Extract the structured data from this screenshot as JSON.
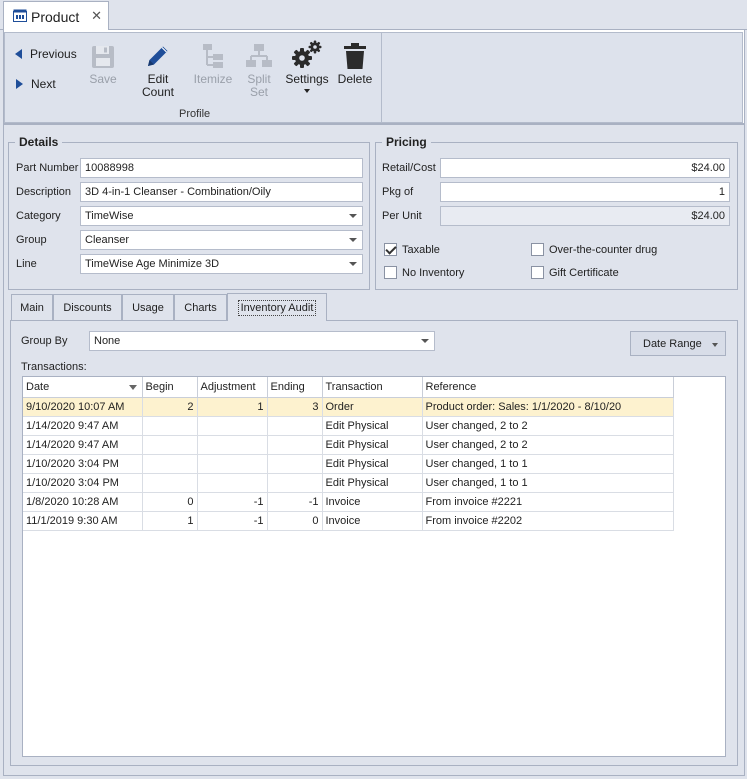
{
  "doc_tab": {
    "title": "Product"
  },
  "ribbon": {
    "previous_label": "Previous",
    "next_label": "Next",
    "save_label": "Save",
    "edit_count_label": "Edit Count",
    "itemize_label": "Itemize",
    "split_set_label_1": "Split",
    "split_set_label_2": "Set",
    "settings_label": "Settings",
    "delete_label": "Delete",
    "group_label": "Profile"
  },
  "details": {
    "legend": "Details",
    "part_number_label": "Part Number",
    "part_number": "10088998",
    "description_label": "Description",
    "description": "3D 4-in-1 Cleanser - Combination/Oily",
    "category_label": "Category",
    "category": "TimeWise",
    "group_label": "Group",
    "group": "Cleanser",
    "line_label": "Line",
    "line": "TimeWise Age Minimize 3D"
  },
  "pricing": {
    "legend": "Pricing",
    "retail_label": "Retail/Cost",
    "retail": "$24.00",
    "pkg_label": "Pkg of",
    "pkg": "1",
    "per_unit_label": "Per Unit",
    "per_unit": "$24.00",
    "taxable_label": "Taxable",
    "taxable": true,
    "otc_label": "Over-the-counter drug",
    "otc": false,
    "no_inventory_label": "No Inventory",
    "no_inventory": false,
    "gift_label": "Gift Certificate",
    "gift": false
  },
  "tabs": {
    "main": "Main",
    "discounts": "Discounts",
    "usage": "Usage",
    "charts": "Charts",
    "inventory_audit": "Inventory Audit"
  },
  "audit": {
    "group_by_label": "Group By",
    "group_by_value": "None",
    "date_range_label": "Date Range",
    "transactions_label": "Transactions:",
    "columns": [
      "Date",
      "Begin",
      "Adjustment",
      "Ending",
      "Transaction",
      "Reference"
    ],
    "rows": [
      [
        "9/10/2020 10:07 AM",
        "2",
        "1",
        "3",
        "Order",
        "Product order: Sales: 1/1/2020 - 8/10/20"
      ],
      [
        "1/14/2020 9:47 AM",
        "",
        "",
        "",
        "Edit Physical",
        "User changed, 2 to 2"
      ],
      [
        "1/14/2020 9:47 AM",
        "",
        "",
        "",
        "Edit Physical",
        "User changed, 2 to 2"
      ],
      [
        "1/10/2020 3:04 PM",
        "",
        "",
        "",
        "Edit Physical",
        "User changed, 1 to 1"
      ],
      [
        "1/10/2020 3:04 PM",
        "",
        "",
        "",
        "Edit Physical",
        "User changed, 1 to 1"
      ],
      [
        "1/8/2020 10:28 AM",
        "0",
        "-1",
        "-1",
        "Invoice",
        "From invoice #2221"
      ],
      [
        "11/1/2019 9:30 AM",
        "1",
        "-1",
        "0",
        "Invoice",
        "From invoice #2202"
      ]
    ]
  },
  "colors": {
    "accent": "#1f4e99",
    "selected_row": "#fdf2cf",
    "panel": "#dfe3ec"
  }
}
